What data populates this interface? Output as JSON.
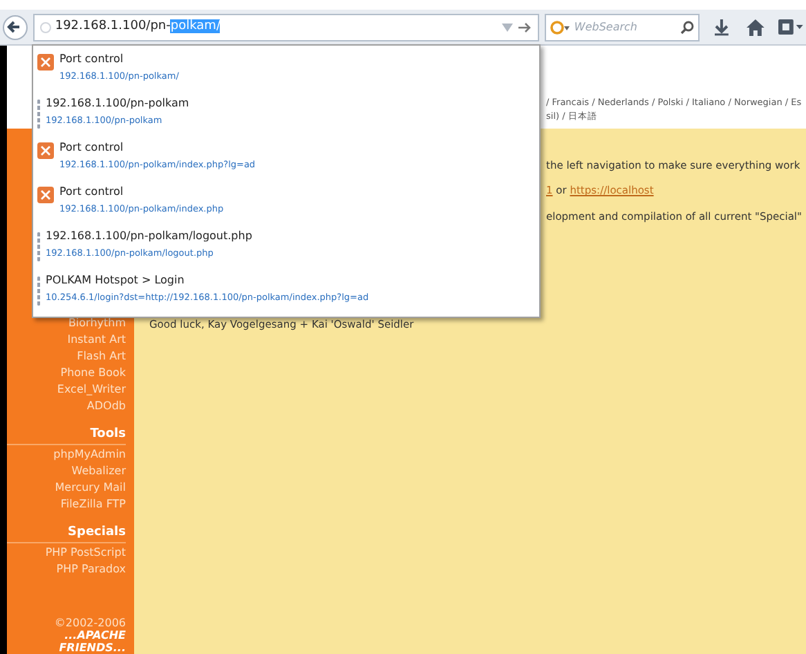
{
  "toolbar": {
    "address": {
      "typed": "192.168.1.100/pn-",
      "autocompleted": "polkam/"
    },
    "search": {
      "placeholder": "WebSearch"
    }
  },
  "suggestions": [
    {
      "kind": "favicon",
      "title": "Port control",
      "url": "192.168.1.100/pn-polkam/"
    },
    {
      "kind": "blank",
      "title": "192.168.1.100/pn-polkam",
      "url": "192.168.1.100/pn-polkam"
    },
    {
      "kind": "favicon",
      "title": "Port control",
      "url": "192.168.1.100/pn-polkam/index.php?lg=ad"
    },
    {
      "kind": "favicon",
      "title": "Port control",
      "url": "192.168.1.100/pn-polkam/index.php"
    },
    {
      "kind": "blank",
      "title": "192.168.1.100/pn-polkam/logout.php",
      "url": "192.168.1.100/pn-polkam/logout.php"
    },
    {
      "kind": "blank",
      "title": "POLKAM Hotspot > Login",
      "url": "10.254.6.1/login?dst=http://192.168.1.100/pn-polkam/index.php?lg=ad"
    }
  ],
  "languages": [
    "/ Francais / Nederlands / Polski / Italiano / Norwegian / Es",
    "sil) / 日本語"
  ],
  "content": [
    {
      "kind": "text",
      "text": "the left navigation to make sure everything work"
    },
    {
      "kind": "links",
      "prefix": "1",
      "middle": " or ",
      "link": "https://localhost"
    },
    {
      "kind": "text",
      "text": "elopment and compilation of all current \"Special\""
    }
  ],
  "closing": "Good luck, Kay Vogelgesang + Kai 'Oswald' Seidler",
  "sidebar": [
    {
      "items": [
        "Biorhythm",
        "Instant Art",
        "Flash Art",
        "Phone Book",
        "Excel_Writer",
        "ADOdb"
      ]
    },
    {
      "heading": "Tools",
      "items": [
        "phpMyAdmin",
        "Webalizer",
        "Mercury Mail",
        "FileZilla FTP"
      ]
    },
    {
      "heading": "Specials",
      "items": [
        "PHP PostScript",
        "PHP Paradox"
      ]
    }
  ],
  "footer": {
    "copyright": "©2002-2006",
    "brand": [
      "...APACHE",
      "FRIENDS..."
    ]
  }
}
